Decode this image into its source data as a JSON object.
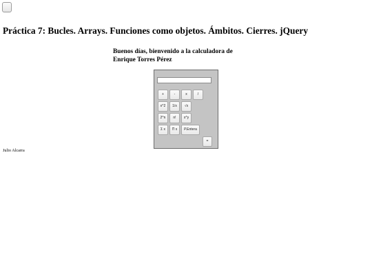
{
  "page": {
    "title": "Práctica 7: Bucles. Arrays. Funciones como objetos. Ámbitos. Cierres. jQuery",
    "welcome_line1": "Buenos días, bienvenido a la calculadora de",
    "welcome_line2": "Enrique Torres Pérez",
    "author": "Julio Alcarra"
  },
  "calculator": {
    "display_value": "",
    "keys": {
      "add": "+",
      "subtract": "-",
      "multiply": "x",
      "divide": "/",
      "square": "x^2",
      "reciprocal": "1/x",
      "sqrt": "√x",
      "pow2n": "2^n",
      "factorial": "n!",
      "power": "x^y",
      "sum": "Σ x",
      "product": "Π x",
      "integer_part": "P.Entera",
      "equals": "="
    }
  }
}
